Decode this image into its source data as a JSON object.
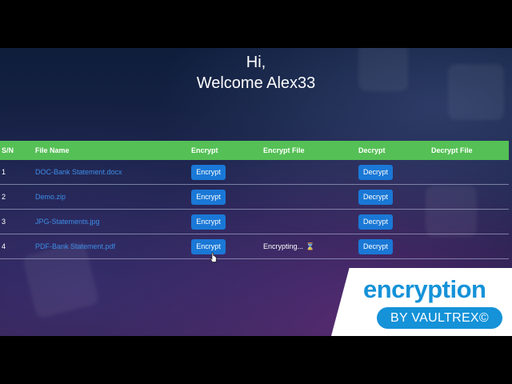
{
  "header": {
    "greeting": "Hi,",
    "welcome": "Welcome Alex33"
  },
  "table": {
    "columns": [
      "S/N",
      "File Name",
      "Encrypt",
      "Encrypt File",
      "Decrypt",
      "Decrypt File"
    ],
    "rows": [
      {
        "sn": "1",
        "name": "DOC-Bank Statement.docx",
        "encrypt_label": "Encrypt",
        "encrypt_file": "",
        "decrypt_label": "Decrypt",
        "decrypt_file": ""
      },
      {
        "sn": "2",
        "name": "Demo.zip",
        "encrypt_label": "Encrypt",
        "encrypt_file": "",
        "decrypt_label": "Decrypt",
        "decrypt_file": ""
      },
      {
        "sn": "3",
        "name": "JPG-Statements.jpg",
        "encrypt_label": "Encrypt",
        "encrypt_file": "",
        "decrypt_label": "Decrypt",
        "decrypt_file": ""
      },
      {
        "sn": "4",
        "name": "PDF-Bank Statement.pdf",
        "encrypt_label": "Encrypt",
        "encrypt_file": "Encrypting...",
        "decrypt_label": "Decrypt",
        "decrypt_file": ""
      }
    ]
  },
  "status_icon": "hourglass-icon",
  "branding": {
    "word": "encryption",
    "byline": "BY VAULTREX©"
  },
  "colors": {
    "header_bg": "#55c055",
    "button_bg": "#1a78d6",
    "link": "#3e8de8",
    "brand": "#1592d8"
  }
}
